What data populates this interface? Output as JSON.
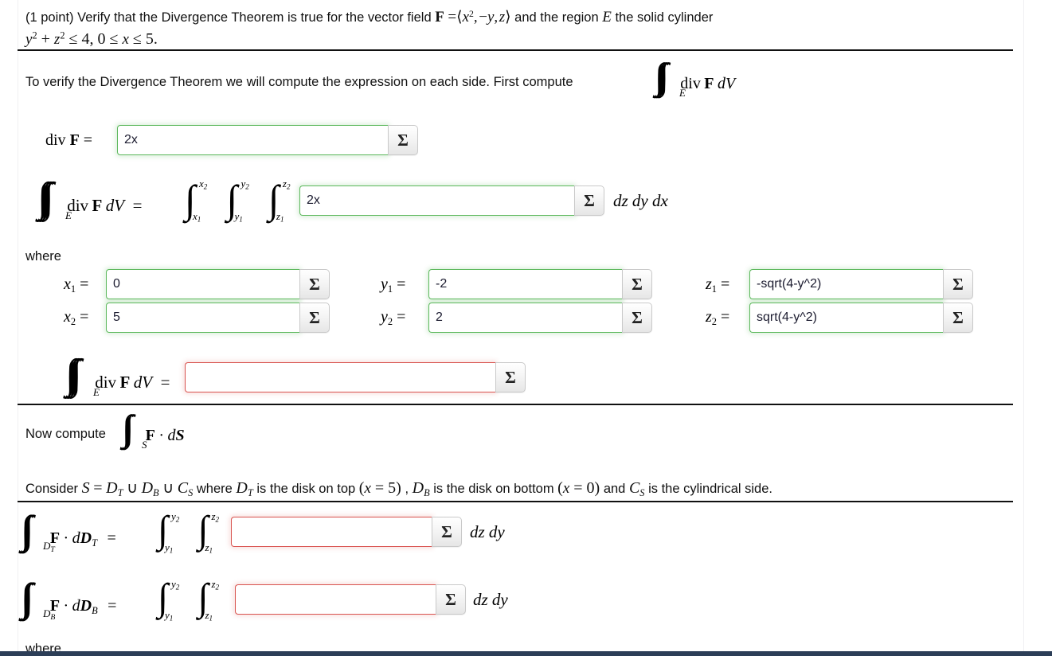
{
  "problem": {
    "points_label": "(1 point)",
    "statement_part1": "Verify that the Divergence Theorem is true for the vector field",
    "vector_field_F": "F",
    "vector_field_value": "⟨x², −y, z⟩",
    "statement_part2": "and the region",
    "region_symbol": "E",
    "statement_part3": "the solid cylinder",
    "region_inequality": "y² + z² ≤ 4, 0 ≤ x ≤ 5."
  },
  "intro": {
    "text": "To verify the Divergence Theorem we will compute the expression on each side. First compute",
    "integral_label": "∭ₑ div F dV"
  },
  "divF_row": {
    "label": "div F =",
    "value": "2x",
    "sigma": "Σ"
  },
  "triple_integral_row": {
    "lhs": "∭ₑ div F dV =",
    "limits": [
      {
        "upper": "x₂",
        "lower": "x₁"
      },
      {
        "upper": "y₂",
        "lower": "y₁"
      },
      {
        "upper": "z₂",
        "lower": "z₁"
      }
    ],
    "value": "2x",
    "sigma": "Σ",
    "differentials": "dz dy dx"
  },
  "where_label": "where",
  "bounds": [
    {
      "name": "x1",
      "label_base": "x",
      "label_sub": "1",
      "eq": "=",
      "value": "0",
      "sigma": "Σ"
    },
    {
      "name": "x2",
      "label_base": "x",
      "label_sub": "2",
      "eq": "=",
      "value": "5",
      "sigma": "Σ"
    },
    {
      "name": "y1",
      "label_base": "y",
      "label_sub": "1",
      "eq": "=",
      "value": "-2",
      "sigma": "Σ"
    },
    {
      "name": "y2",
      "label_base": "y",
      "label_sub": "2",
      "eq": "=",
      "value": "2",
      "sigma": "Σ"
    },
    {
      "name": "z1",
      "label_base": "z",
      "label_sub": "1",
      "eq": "=",
      "value": "-sqrt(4-y^2)",
      "sigma": "Σ"
    },
    {
      "name": "z2",
      "label_base": "z",
      "label_sub": "2",
      "eq": "=",
      "value": "sqrt(4-y^2)",
      "sigma": "Σ"
    }
  ],
  "triple_result_row": {
    "lhs": "∭ₑ div F dV =",
    "value": "",
    "sigma": "Σ"
  },
  "now_compute": {
    "text": "Now compute",
    "integral_label": "∬ₛ F · dS"
  },
  "consider": {
    "text": "Consider S = D_T ∪ D_B ∪ C_S where D_T is the disk on top (x = 5) , D_B is the disk on bottom (x = 0) and C_S is the cylindrical side.",
    "parts": {
      "lead": "Consider",
      "S": "S",
      "eq": "=",
      "DT": "D",
      "DT_sub": "T",
      "cup": "∪",
      "DB": "D",
      "DB_sub": "B",
      "CS": "C",
      "CS_sub": "S",
      "where": "where",
      "is_disk_top": "is the disk on top",
      "top_cond": "(x = 5)",
      "comma": ",",
      "is_disk_bottom": "is the disk on bottom",
      "bottom_cond": "(x = 0)",
      "and": "and",
      "is_cyl_side": "is the cylindrical side."
    }
  },
  "surface_rows": [
    {
      "name": "DT",
      "lhs_integral_sub": "D",
      "lhs_integral_sub2": "T",
      "lhs_text": "F · dD",
      "lhs_text_sub": "T",
      "eq": "=",
      "limits": [
        {
          "upper": "y₂",
          "lower": "y₁"
        },
        {
          "upper": "z₂",
          "lower": "z₁"
        }
      ],
      "value": "",
      "sigma": "Σ",
      "differentials": "dz dy"
    },
    {
      "name": "DB",
      "lhs_integral_sub": "D",
      "lhs_integral_sub2": "B",
      "lhs_text": "F · dD",
      "lhs_text_sub": "B",
      "eq": "=",
      "limits": [
        {
          "upper": "y₂",
          "lower": "y₁"
        },
        {
          "upper": "z₂",
          "lower": "z₁"
        }
      ],
      "value": "",
      "sigma": "Σ",
      "differentials": "dz dy"
    }
  ],
  "footer_partial": {
    "cut_off_text": "where"
  },
  "colors": {
    "valid_border": "#5cb85c",
    "invalid_border": "#d9534f",
    "rule": "#111111",
    "bottom_bar": "#2c3e57",
    "text": "#111111"
  }
}
